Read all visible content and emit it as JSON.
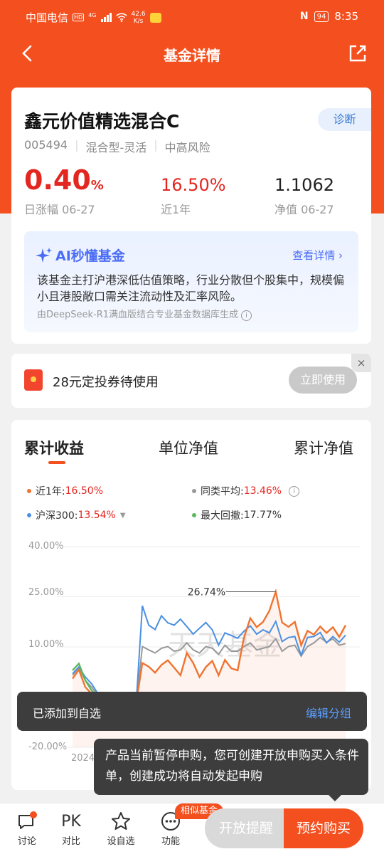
{
  "status_bar": {
    "carrier": "中国电信",
    "hd": "HD",
    "net": "4G",
    "speed_value": "42.6",
    "speed_unit": "K/s",
    "battery": "94",
    "time": "8:35"
  },
  "nav": {
    "title": "基金详情"
  },
  "fund": {
    "name": "鑫元价值精选混合C",
    "diagnose_label": "诊断",
    "code": "005494",
    "type": "混合型-灵活",
    "risk": "中高风险",
    "daily_change_value": "0.40",
    "daily_change_unit": "%",
    "daily_change_label": "日涨幅 06-27",
    "year_return_value": "16.50%",
    "year_return_label": "近1年",
    "nav_value": "1.1062",
    "nav_label": "净值 06-27"
  },
  "ai_panel": {
    "title": "AI秒懂基金",
    "more_label": "查看详情",
    "description": "该基金主打沪港深低估值策略，行业分散但个股集中，规模偏小且港股敞口需关注流动性及汇率风险。",
    "source": "由DeepSeek-R1满血版结合专业基金数据库生成"
  },
  "coupon": {
    "text": "28元定投券待使用",
    "button_label": "立即使用",
    "close": "×"
  },
  "chart_tabs": [
    "累计收益",
    "单位净值",
    "累计净值"
  ],
  "legend": {
    "fund_label": "近1年:",
    "fund_value": "16.50%",
    "peer_label": "同类平均:",
    "peer_value": "13.46%",
    "index_label": "沪深300:",
    "index_value": "13.54%",
    "drawdown_label": "最大回撤:",
    "drawdown_value": "17.77%"
  },
  "colors": {
    "brand": "#f4501f",
    "fund_line": "#f07330",
    "peer_line": "#999999",
    "index_line": "#4a90e2",
    "drawdown": "#5cb85c",
    "rise": "#e3261f"
  },
  "chart_data": {
    "type": "line",
    "y_ticks": [
      "40.00%",
      "25.00%",
      "10.00%",
      "-20.00%"
    ],
    "ylim": [
      -20,
      40
    ],
    "x_label_partial": "2024",
    "peak_annotation": "26.74%",
    "series": [
      {
        "values": [
          0.5,
          3.2,
          -2,
          -4,
          -6,
          -7,
          -7.5,
          -8.2,
          -8.5,
          -8,
          -7,
          5.2,
          4.1,
          2.3,
          4.6,
          6,
          3.8,
          1.5,
          8.2,
          5.2,
          1,
          4,
          5.8,
          1.5,
          6.1,
          3.6,
          3,
          12.8,
          18.6,
          15.9,
          17.5,
          20.8,
          26.5,
          17.3,
          16,
          17.5,
          10.5,
          14.8,
          13.7,
          16.1,
          14.2,
          15.9,
          13,
          16.5
        ]
      },
      {
        "values": [
          1.5,
          3.8,
          0,
          -2,
          -4.5,
          -6,
          -7,
          -8,
          -9,
          -8.5,
          -7.5,
          10.1,
          9.1,
          8.2,
          9.6,
          10.1,
          8.7,
          9.1,
          11.2,
          9.1,
          8.2,
          10.1,
          9.6,
          7.8,
          10.5,
          8.7,
          8.7,
          10.1,
          11.2,
          9.1,
          9.6,
          10.1,
          12.4,
          8.7,
          10.1,
          10.5,
          7.3,
          10.1,
          11.2,
          12.8,
          11.4,
          12.4,
          10.5,
          11
        ]
      },
      {
        "values": [
          2,
          4,
          1,
          -1,
          -4,
          -6,
          -7,
          -8,
          -8.5,
          -8,
          -7.5,
          22.3,
          16.5,
          15.2,
          19.3,
          17.2,
          16.5,
          18.3,
          16.1,
          13.8,
          15.6,
          17.3,
          15.1,
          10.5,
          14.2,
          13.4,
          12.6,
          14.7,
          16.3,
          13.8,
          15.1,
          14.2,
          17.6,
          11.6,
          12.8,
          13.1,
          7.5,
          12.8,
          13.1,
          14.3,
          11.2,
          13.1,
          11.4,
          13.5
        ]
      }
    ],
    "drawdown_values": [
      3,
      5,
      0,
      -3,
      -5,
      -6,
      -7,
      -7.5
    ]
  },
  "toast": {
    "message": "已添加到自选",
    "action": "编辑分组"
  },
  "tooltip": {
    "text": "产品当前暂停申购，您可创建开放申购买入条件单，创建成功将自动发起申购"
  },
  "bottom_bar": {
    "items": [
      {
        "label": "讨论"
      },
      {
        "label": "对比",
        "icon_text": "PK"
      },
      {
        "label": "设自选"
      },
      {
        "label": "功能"
      }
    ],
    "similar_tag": "相似基金",
    "open_reminder": "开放提醒",
    "reserve_buy": "预约购买"
  }
}
